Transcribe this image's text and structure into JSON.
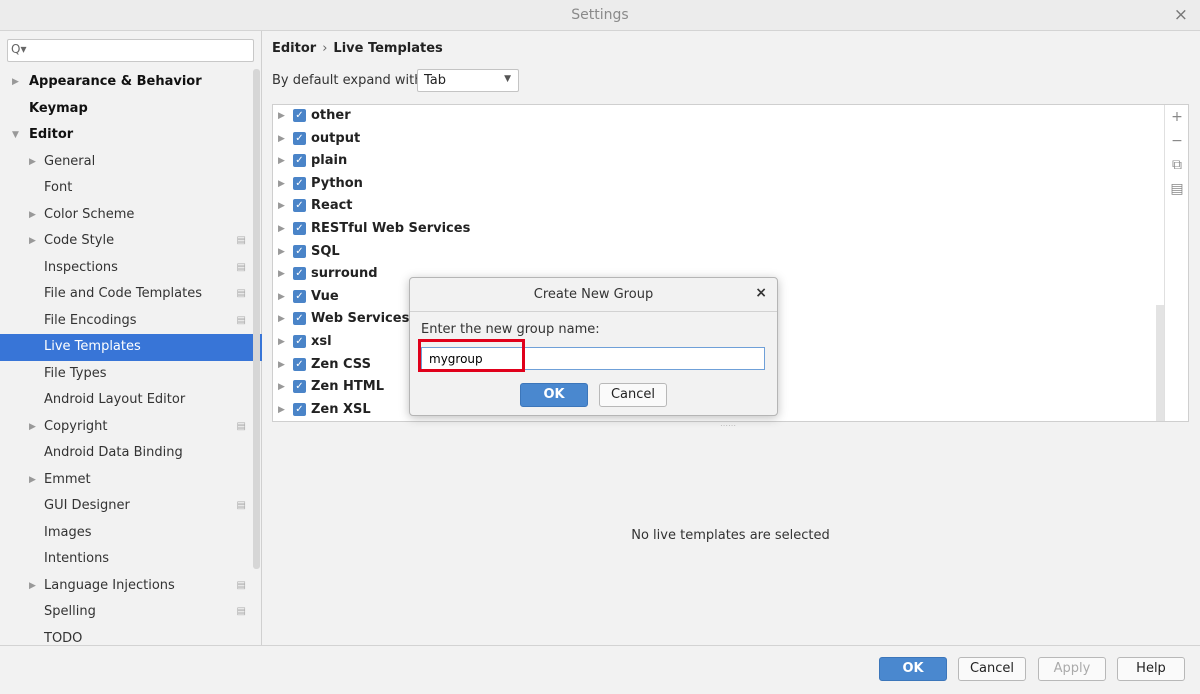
{
  "window": {
    "title": "Settings",
    "close_glyph": "×"
  },
  "search": {
    "icon": "search-icon",
    "glyph": "Q▾",
    "value": ""
  },
  "sidebar": {
    "items": [
      {
        "label": "Appearance & Behavior"
      },
      {
        "label": "Keymap"
      },
      {
        "label": "Editor"
      },
      {
        "label": "General"
      },
      {
        "label": "Font"
      },
      {
        "label": "Color Scheme"
      },
      {
        "label": "Code Style"
      },
      {
        "label": "Inspections"
      },
      {
        "label": "File and Code Templates"
      },
      {
        "label": "File Encodings"
      },
      {
        "label": "Live Templates"
      },
      {
        "label": "File Types"
      },
      {
        "label": "Android Layout Editor"
      },
      {
        "label": "Copyright"
      },
      {
        "label": "Android Data Binding"
      },
      {
        "label": "Emmet"
      },
      {
        "label": "GUI Designer"
      },
      {
        "label": "Images"
      },
      {
        "label": "Intentions"
      },
      {
        "label": "Language Injections"
      },
      {
        "label": "Spelling"
      },
      {
        "label": "TODO"
      }
    ]
  },
  "breadcrumb": {
    "parent": "Editor",
    "separator": "›",
    "current": "Live Templates"
  },
  "expand": {
    "label": "By default expand with",
    "value": "Tab"
  },
  "groups": [
    {
      "label": "other",
      "checked": true
    },
    {
      "label": "output",
      "checked": true
    },
    {
      "label": "plain",
      "checked": true
    },
    {
      "label": "Python",
      "checked": true
    },
    {
      "label": "React",
      "checked": true
    },
    {
      "label": "RESTful Web Services",
      "checked": true
    },
    {
      "label": "SQL",
      "checked": true
    },
    {
      "label": "surround",
      "checked": true
    },
    {
      "label": "Vue",
      "checked": true
    },
    {
      "label": "Web Services",
      "checked": true
    },
    {
      "label": "xsl",
      "checked": true
    },
    {
      "label": "Zen CSS",
      "checked": true
    },
    {
      "label": "Zen HTML",
      "checked": true
    },
    {
      "label": "Zen XSL",
      "checked": true
    }
  ],
  "tools": {
    "add": "+",
    "remove": "−",
    "copy": "⧉",
    "restore": "▤"
  },
  "empty_message": "No live templates are selected",
  "dialog": {
    "title": "Create New Group",
    "close_glyph": "×",
    "prompt": "Enter the new group name:",
    "input_value": "mygroup",
    "ok_label": "OK",
    "cancel_label": "Cancel"
  },
  "footer": {
    "ok_label": "OK",
    "cancel_label": "Cancel",
    "apply_label": "Apply",
    "help_label": "Help"
  },
  "colors": {
    "selection": "#3875d7",
    "primary_button": "#4a88cf",
    "highlight_box": "#e0001b",
    "checkbox": "#4a84c8"
  }
}
